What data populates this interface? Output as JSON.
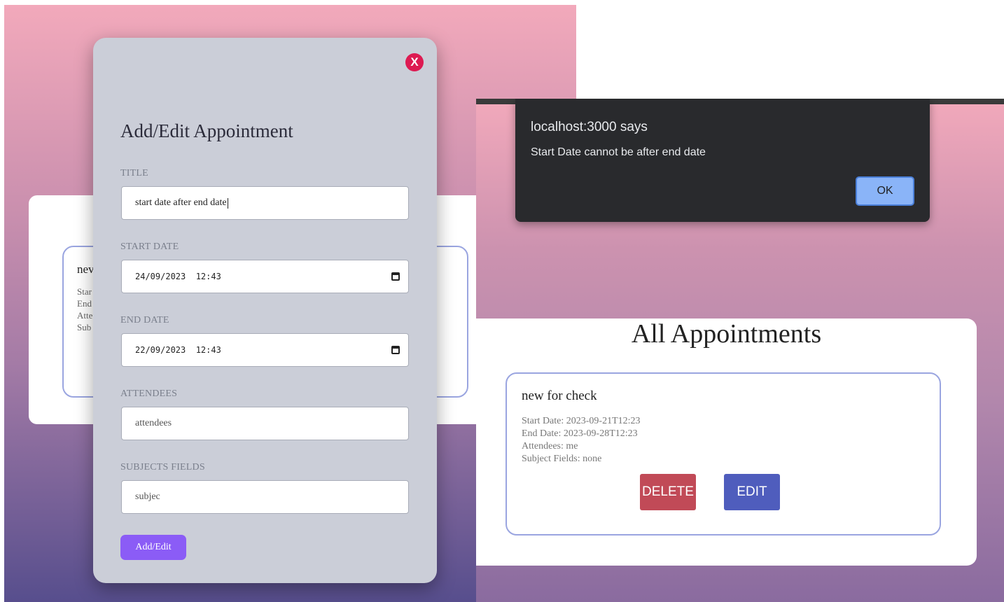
{
  "colors": {
    "gradient_top": "#f2a9bb",
    "gradient_bottom": "#574e8d",
    "modal_bg": "#cbced8",
    "close_button": "#dd1a52",
    "submit_button": "#8b5cf6",
    "delete_button": "#c14a57",
    "edit_button": "#4f5dbd",
    "alert_bg": "#292a2d",
    "alert_ok": "#8ab4f8",
    "card_border": "#9aa5e0"
  },
  "left_background": {
    "card_title_peek": "nev",
    "card_lines_peek": [
      "Star",
      "End",
      "Atte",
      "Sub"
    ]
  },
  "modal": {
    "close_label": "X",
    "close_icon": "close-icon",
    "title": "Add/Edit Appointment",
    "fields": {
      "title": {
        "label": "TITLE",
        "value": "start date after end date"
      },
      "start_date": {
        "label": "START DATE",
        "value": "24/09/2023  12:43"
      },
      "end_date": {
        "label": "END DATE",
        "value": "22/09/2023  12:43"
      },
      "attendees": {
        "label": "ATTENDEES",
        "value": "attendees"
      },
      "subjects": {
        "label": "SUBJECTS FIELDS",
        "value": "subjec"
      }
    },
    "submit_label": "Add/Edit"
  },
  "alert": {
    "origin": "localhost:3000 says",
    "message": "Start Date cannot be after end date",
    "ok_label": "OK"
  },
  "appointments": {
    "heading": "All Appointments",
    "card": {
      "title": "new for check",
      "start": "Start Date: 2023-09-21T12:23",
      "end": "End Date: 2023-09-28T12:23",
      "attendees": "Attendees: me",
      "subjects": "Subject Fields: none",
      "delete_label": "DELETE",
      "edit_label": "EDIT"
    }
  }
}
